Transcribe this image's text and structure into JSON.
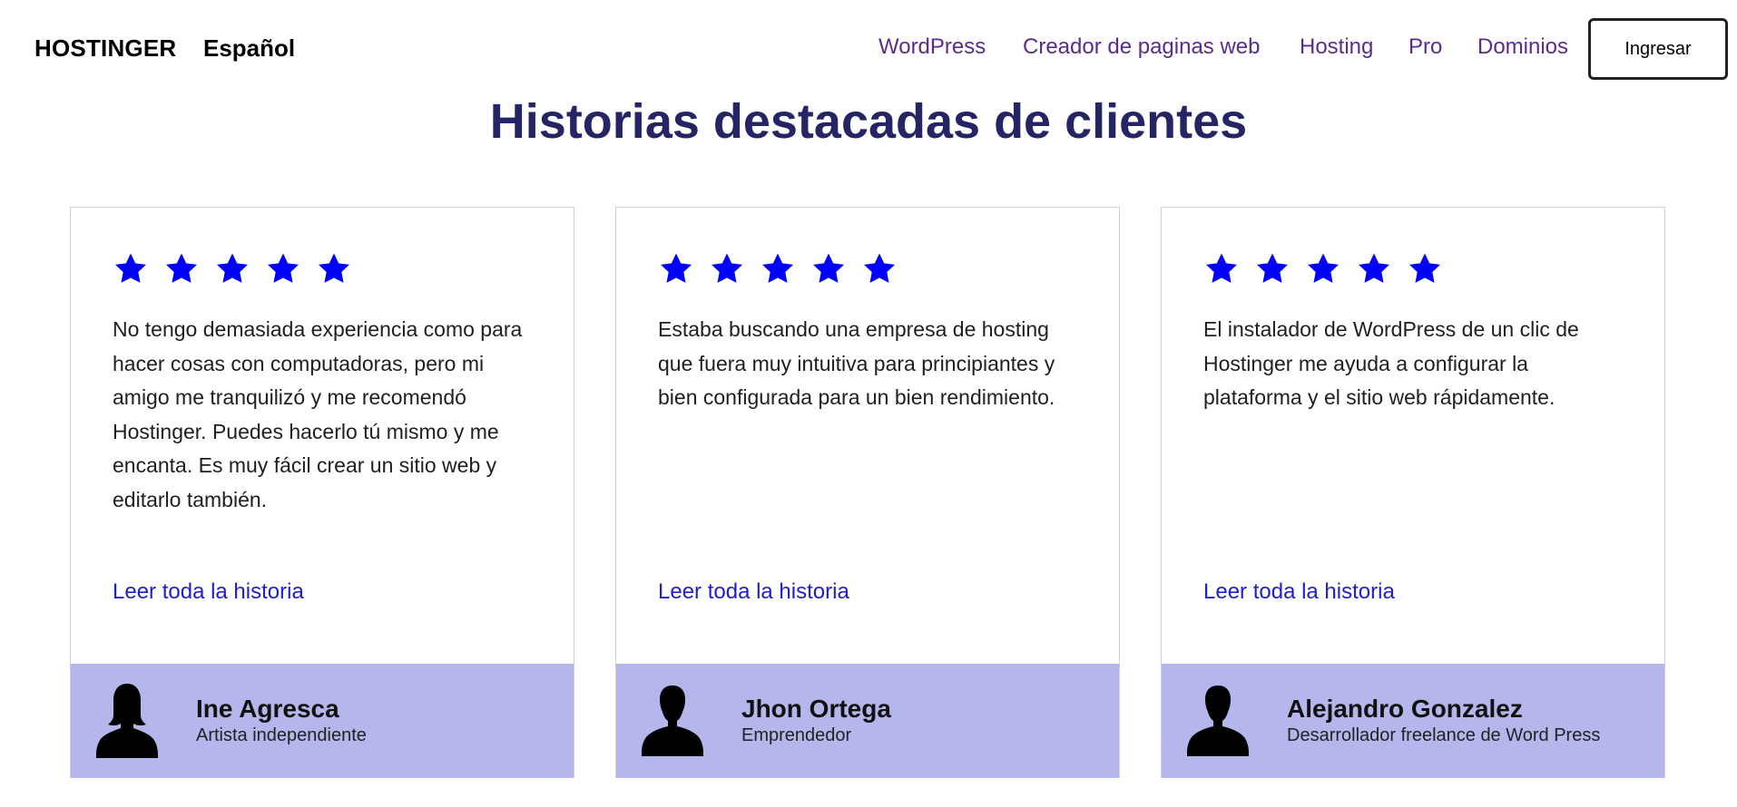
{
  "header": {
    "brand": "HOSTINGER",
    "language": "Español",
    "nav": [
      "WordPress",
      "Creador de paginas web",
      "Hosting",
      "Pro",
      "Dominios"
    ],
    "login_label": "Ingresar"
  },
  "section": {
    "title": "Historias destacadas de clientes"
  },
  "colors": {
    "nav_link": "#5b2c8a",
    "title": "#252565",
    "star": "#0000ff",
    "read_more_link": "#1f20c8",
    "card_footer": "#b4b6ec"
  },
  "testimonials": [
    {
      "rating": 5,
      "quote": "No tengo demasiada experiencia como para hacer cosas con computadoras, pero mi amigo me tranquilizó y me recomendó Hostinger. Puedes hacerlo tú mismo y me encanta. Es muy fácil crear un sitio web y editarlo también.",
      "link": "Leer toda la historia",
      "name": "Ine Agresca",
      "role": "Artista independiente",
      "avatar_icon": "female-silhouette-icon"
    },
    {
      "rating": 5,
      "quote": "Estaba buscando una empresa de hosting que fuera muy intuitiva para principiantes y bien configurada para un bien rendimiento.",
      "link": "Leer toda la historia",
      "name": "Jhon Ortega",
      "role": "Emprendedor",
      "avatar_icon": "male-silhouette-icon"
    },
    {
      "rating": 5,
      "quote": "El instalador de WordPress de un clic de Hostinger me ayuda a configurar la plataforma y el sitio web rápidamente.",
      "link": "Leer toda la historia",
      "name": "Alejandro Gonzalez",
      "role": "Desarrollador freelance de Word Press",
      "avatar_icon": "male-silhouette-icon"
    }
  ]
}
